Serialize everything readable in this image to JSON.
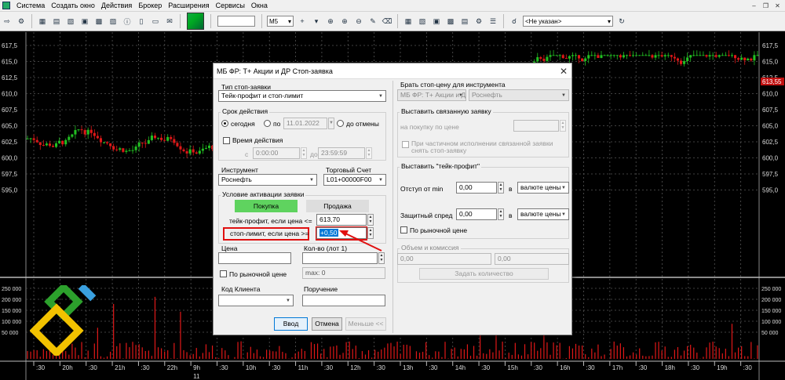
{
  "menu": {
    "items": [
      "Система",
      "Создать окно",
      "Действия",
      "Брокер",
      "Расширения",
      "Сервисы",
      "Окна"
    ]
  },
  "toolbar": {
    "interval": "M5",
    "client_select": "<Не указан>"
  },
  "chart": {
    "price_labels": [
      "617,5",
      "615,0",
      "612,5",
      "610,0",
      "607,5",
      "605,0",
      "602,5",
      "600,0",
      "597,5",
      "595,0"
    ],
    "current_price": "613,55",
    "volume_labels": [
      "250 000",
      "200 000",
      "150 000",
      "100 000",
      "50 000"
    ],
    "time_labels": [
      ":30",
      "20h",
      ":30",
      "21h",
      ":30",
      "22h",
      "9h",
      ":30",
      "10h",
      ":30",
      "11h",
      ":30",
      "12h",
      ":30",
      "13h",
      ":30",
      "14h",
      ":30",
      "15h",
      ":30",
      "16h",
      ":30",
      "17h",
      ":30",
      "18h",
      ":30",
      "19h",
      ":30"
    ],
    "date_label": "11",
    "colors": {
      "up": "#22c022",
      "down": "#e01818",
      "grid": "#555555"
    }
  },
  "dialog": {
    "title": "МБ ФР: Т+ Акции и ДР Стоп-заявка",
    "stop_type": {
      "label": "Тип стоп-заявки",
      "value": "Тейк-профит и стоп-лимит"
    },
    "validity": {
      "label": "Срок действия",
      "today": "сегодня",
      "until": "по",
      "date": "11.01.2022",
      "until_cancel": "до отмены",
      "time_label": "Время действия",
      "from": "с",
      "from_time": "0:00:00",
      "to": "до",
      "to_time": "23:59:59"
    },
    "instrument": {
      "label": "Инструмент",
      "value": "Роснефть"
    },
    "account": {
      "label": "Торговый Счет",
      "value": "L01+00000F00"
    },
    "activation": {
      "label": "Условие активации заявки",
      "buy": "Покупка",
      "sell": "Продажа",
      "tp_label": "тейк-профит, если цена <=",
      "tp_value": "613,70",
      "sl_label": "стоп-лимит, если цена >=",
      "sl_value": "+0,50"
    },
    "price": {
      "label": "Цена",
      "market": "По рыночной цене"
    },
    "qty": {
      "label": "Кол-во (лот 1)",
      "max": "max: 0"
    },
    "client": {
      "label": "Код Клиента"
    },
    "order": {
      "label": "Поручение"
    },
    "buttons": {
      "submit": "Ввод",
      "cancel": "Отмена",
      "less": "Меньше <<"
    },
    "right": {
      "stop_instr_label": "Брать стоп-цену для инструмента",
      "stop_instr_class": "МБ ФР: Т+ Акции и Д",
      "stop_instr_sec": "Роснефть",
      "linked_label": "Выставить связанную заявку",
      "linked_buy": "на покупку по цене",
      "linked_cancel": "При частичном исполнении связанной заявки снять стоп-заявку",
      "tp_group": "Выставить \"тейк-профит\"",
      "offset_label": "Отступ от min",
      "offset_value": "0,00",
      "in": "в",
      "offset_unit": "валюте цены",
      "spread_label": "Защитный спред",
      "spread_value": "0,00",
      "spread_unit": "валюте цены",
      "spread_market": "По рыночной цене",
      "volume_group": "Объем и комиссия",
      "vol_a": "0,00",
      "vol_b": "0,00",
      "set_qty": "Задать количество"
    }
  }
}
